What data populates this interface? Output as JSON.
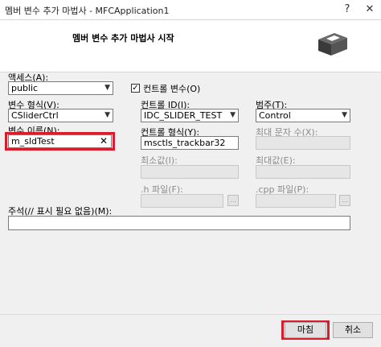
{
  "window": {
    "title": "멤버 변수 추가 마법사 - MFCApplication1",
    "help_glyph": "?",
    "close_glyph": "✕"
  },
  "header": {
    "title": "멤버 변수 추가 마법사 시작"
  },
  "form": {
    "access_label": "액세스(A):",
    "access_value": "public",
    "control_var_label": "컨트롤 변수(O)",
    "control_var_checked": true,
    "var_type_label": "변수 형식(V):",
    "var_type_value": "CSliderCtrl",
    "control_id_label": "컨트롤 ID(I):",
    "control_id_value": "IDC_SLIDER_TEST",
    "category_label": "범주(T):",
    "category_value": "Control",
    "var_name_label": "변수 이름(N):",
    "var_name_value": "m_sldTest",
    "control_type_label": "컨트롤 형식(Y):",
    "control_type_value": "msctls_trackbar32",
    "max_chars_label": "최대 문자 수(X):",
    "min_label": "최소값(I):",
    "max_label": "최대값(E):",
    "h_file_label": ".h 파일(F):",
    "cpp_file_label": ".cpp 파일(P):",
    "browse_label": "...",
    "comment_label": "주석(// 표시 필요 없음)(M):",
    "comment_value": ""
  },
  "footer": {
    "finish_label": "마침",
    "cancel_label": "취소"
  },
  "colors": {
    "highlight": "#d81e2c",
    "dialog_bg": "#f0f0f0"
  }
}
